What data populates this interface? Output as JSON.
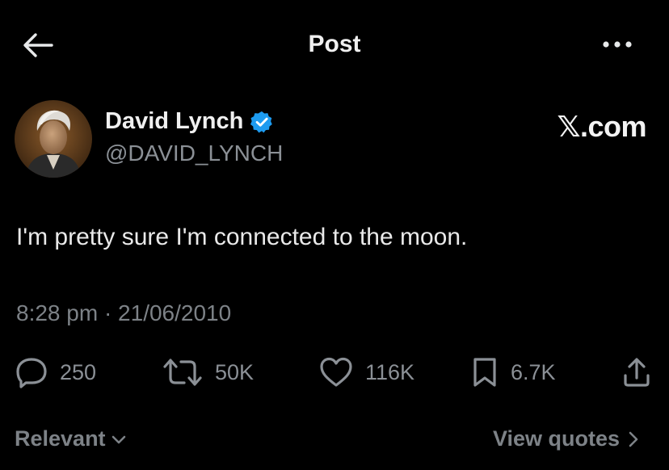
{
  "header": {
    "title": "Post",
    "back_icon": "arrow-left-icon",
    "more_icon": "more-horizontal-icon"
  },
  "author": {
    "name": "David Lynch",
    "handle": "@DAVID_LYNCH",
    "verified_icon": "verified-badge-icon",
    "verified_color": "#1d9bf0"
  },
  "watermark": "𝕏.com",
  "post": {
    "text": "I'm pretty sure I'm connected to the moon.",
    "timestamp": "8:28 pm · 21/06/2010"
  },
  "actions": {
    "replies": "250",
    "reposts": "50K",
    "likes": "116K",
    "bookmarks": "6.7K"
  },
  "footer": {
    "sort_label": "Relevant",
    "view_quotes_label": "View quotes"
  },
  "colors": {
    "background": "#000000",
    "primary_text": "#e7e9ea",
    "secondary_text": "#8b9096",
    "accent": "#1d9bf0"
  }
}
